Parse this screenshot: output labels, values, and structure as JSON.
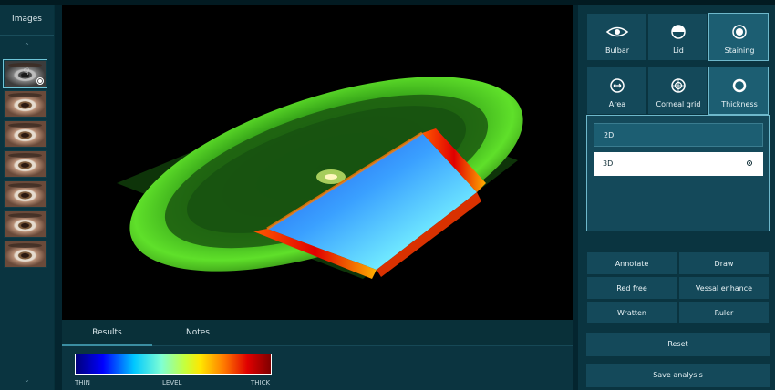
{
  "sidebar": {
    "title": "Images",
    "thumbnail_count": 7
  },
  "results_tabs": [
    {
      "label": "Results",
      "active": true
    },
    {
      "label": "Notes",
      "active": false
    }
  ],
  "colorbar": {
    "labels": [
      "THIN",
      "LEVEL",
      "THICK"
    ]
  },
  "modes_row1": [
    {
      "label": "Bulbar",
      "icon": "eye-icon",
      "active": false
    },
    {
      "label": "Lid",
      "icon": "half-circle-icon",
      "active": false
    },
    {
      "label": "Staining",
      "icon": "target-dot-icon",
      "active": true
    }
  ],
  "modes_row2": [
    {
      "label": "Area",
      "icon": "horizontal-arrows-circle-icon",
      "active": false
    },
    {
      "label": "Corneal grid",
      "icon": "concentric-grid-icon",
      "active": false
    },
    {
      "label": "Thickness",
      "icon": "ring-icon",
      "active": true
    }
  ],
  "view_options": [
    {
      "label": "2D",
      "selected": false
    },
    {
      "label": "3D",
      "selected": true
    }
  ],
  "tools": [
    "Annotate",
    "Draw",
    "Red free",
    "Vessal enhance",
    "Wratten",
    "Ruler"
  ],
  "actions": {
    "reset": "Reset",
    "save": "Save analysis"
  },
  "colors": {
    "background": "#04252f",
    "panel": "#0a3440",
    "button": "#14495a",
    "active_border": "#6eb8cb"
  }
}
